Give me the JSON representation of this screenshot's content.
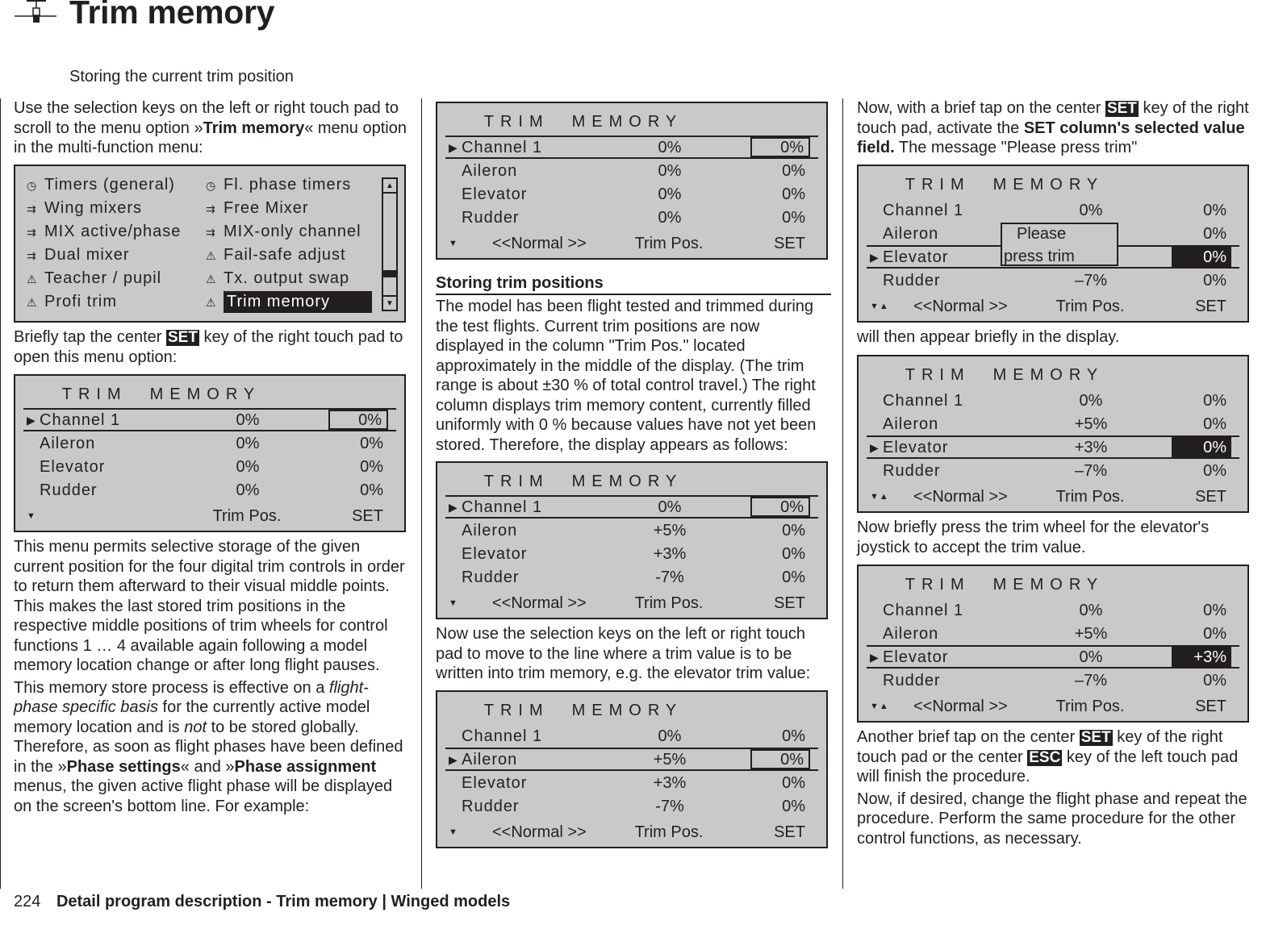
{
  "header": {
    "icon": "servo-trim-icon",
    "title": "Trim memory",
    "subtitle": "Storing the current trim position"
  },
  "col1": {
    "p1": [
      "Use the selection keys on the left or right touch pad to scroll to the menu option »",
      "Trim memory",
      "« menu option in the multi-function menu:"
    ],
    "menu": {
      "items_left": [
        {
          "icon": "clock-icon",
          "label": "Timers (general)"
        },
        {
          "icon": "mixer-icon",
          "label": "Wing mixers"
        },
        {
          "icon": "mixer-icon",
          "label": "MIX active/phase"
        },
        {
          "icon": "mixer-icon",
          "label": "Dual mixer"
        },
        {
          "icon": "warning-icon",
          "label": "Teacher / pupil"
        },
        {
          "icon": "warning-icon",
          "label": "Profi trim"
        }
      ],
      "items_right": [
        {
          "icon": "clock-icon",
          "label": "Fl. phase timers"
        },
        {
          "icon": "mixer-icon",
          "label": "Free Mixer"
        },
        {
          "icon": "mixer-icon",
          "label": "MIX-only channel"
        },
        {
          "icon": "warning-icon",
          "label": "Fail-safe adjust"
        },
        {
          "icon": "warning-icon",
          "label": "Tx. output swap"
        },
        {
          "icon": "warning-icon",
          "label": "Trim memory",
          "selected": true
        }
      ],
      "scroll_position": 0.82
    },
    "p2": [
      "Briefly tap the center ",
      "SET",
      " key of the right touch pad to open this menu option:"
    ],
    "p3": "This menu permits selective storage of the given current position for the four digital trim controls in order to return them afterward to their visual middle points. This makes the last stored trim positions in the respective middle positions of trim wheels for control functions 1 … 4 available again following a model memory location change or after long flight pauses.",
    "p4": [
      "This memory store process is effective on a ",
      "flight-phase specific basis",
      " for the currently active model memory location and is ",
      "not",
      " to be stored globally. Therefore, as soon as flight phases have been defined in the »",
      "Phase settings",
      "« and »",
      "Phase assignment",
      " menus, the given active flight phase will be displayed on the screen's bottom line. For example:"
    ]
  },
  "col2": {
    "section_title": "Storing trim positions",
    "p1": "The model has been flight tested and trimmed during the test flights. Current trim positions are now displayed in the column \"Trim Pos.\" located approximately in the middle of the display. (The trim range is about ±30 % of total control travel.) The right column displays trim memory content, currently filled uniformly with 0 % because values have not yet been stored. Therefore, the display appears as follows:",
    "p2": "Now use the selection keys on the left or right touch pad to move to the line where a trim value is to be written into trim memory, e.g. the elevator trim value:"
  },
  "col3": {
    "p1": [
      "Now, with a brief tap on the center ",
      "SET",
      " key of the right touch pad, activate the ",
      "SET column's selected value field.",
      " The message \"Please press trim\""
    ],
    "p2": "will then appear briefly in the display.",
    "p3": "Now briefly press the trim wheel for the elevator's joystick to accept the trim value.",
    "p4": [
      "Another brief tap on the center ",
      "SET",
      " key of the right touch pad or the center ",
      "ESC",
      " key of the left touch pad will finish the procedure."
    ],
    "p5": "Now, if desired, change the flight phase and repeat the procedure. Perform the same procedure for the other control functions, as necessary."
  },
  "screens": {
    "title_a": "TRIM",
    "title_b": "MEMORY",
    "col_trim": "Trim Pos.",
    "col_set": "SET",
    "popup": {
      "line1": "Please",
      "line2": "press trim"
    },
    "s1": {
      "phase": "",
      "arrows": "▼",
      "selected": 0,
      "set_style": "boxed",
      "rows": [
        {
          "name": "Channel 1",
          "trim": "0%",
          "set": "0%"
        },
        {
          "name": "Aileron",
          "trim": "0%",
          "set": "0%"
        },
        {
          "name": "Elevator",
          "trim": "0%",
          "set": "0%"
        },
        {
          "name": "Rudder",
          "trim": "0%",
          "set": "0%"
        }
      ]
    },
    "s2": {
      "phase": "<<Normal >>",
      "arrows": "▼",
      "selected": 0,
      "set_style": "boxed",
      "rows": [
        {
          "name": "Channel 1",
          "trim": "0%",
          "set": "0%"
        },
        {
          "name": "Aileron",
          "trim": "0%",
          "set": "0%"
        },
        {
          "name": "Elevator",
          "trim": "0%",
          "set": "0%"
        },
        {
          "name": "Rudder",
          "trim": "0%",
          "set": "0%"
        }
      ]
    },
    "s3": {
      "phase": "<<Normal >>",
      "arrows": "▼",
      "selected": 0,
      "set_style": "boxed",
      "rows": [
        {
          "name": "Channel 1",
          "trim": "0%",
          "set": "0%"
        },
        {
          "name": "Aileron",
          "trim": "+5%",
          "set": "0%"
        },
        {
          "name": "Elevator",
          "trim": "+3%",
          "set": "0%"
        },
        {
          "name": "Rudder",
          "trim": "-7%",
          "set": "0%"
        }
      ]
    },
    "s4": {
      "phase": "<<Normal >>",
      "arrows": "▼",
      "selected": 1,
      "set_style": "boxed",
      "rows": [
        {
          "name": "Channel 1",
          "trim": "0%",
          "set": "0%"
        },
        {
          "name": "Aileron",
          "trim": "+5%",
          "set": "0%"
        },
        {
          "name": "Elevator",
          "trim": "+3%",
          "set": "0%"
        },
        {
          "name": "Rudder",
          "trim": "-7%",
          "set": "0%"
        }
      ]
    },
    "s5": {
      "phase": "<<Normal >>",
      "arrows": "▼▲",
      "selected": 2,
      "set_style": "inv",
      "popup": true,
      "rows": [
        {
          "name": "Channel 1",
          "trim": "0%",
          "set": "0%"
        },
        {
          "name": "Aileron",
          "trim": "",
          "set": "0%"
        },
        {
          "name": "Elevator",
          "trim": "",
          "set": "0%"
        },
        {
          "name": "Rudder",
          "trim": "–7%",
          "set": "0%"
        }
      ]
    },
    "s6": {
      "phase": "<<Normal >>",
      "arrows": "▼▲",
      "selected": 2,
      "set_style": "inv",
      "rows": [
        {
          "name": "Channel 1",
          "trim": "0%",
          "set": "0%"
        },
        {
          "name": "Aileron",
          "trim": "+5%",
          "set": "0%"
        },
        {
          "name": "Elevator",
          "trim": "+3%",
          "set": "0%"
        },
        {
          "name": "Rudder",
          "trim": "–7%",
          "set": "0%"
        }
      ]
    },
    "s7": {
      "phase": "<<Normal >>",
      "arrows": "▼▲",
      "selected": 2,
      "set_style": "inv",
      "rows": [
        {
          "name": "Channel 1",
          "trim": "0%",
          "set": "0%"
        },
        {
          "name": "Aileron",
          "trim": "+5%",
          "set": "0%"
        },
        {
          "name": "Elevator",
          "trim": "0%",
          "set": "+3%"
        },
        {
          "name": "Rudder",
          "trim": "–7%",
          "set": "0%"
        }
      ]
    }
  },
  "footer": {
    "page_number": "224",
    "title": "Detail program description - Trim memory | Winged models"
  }
}
